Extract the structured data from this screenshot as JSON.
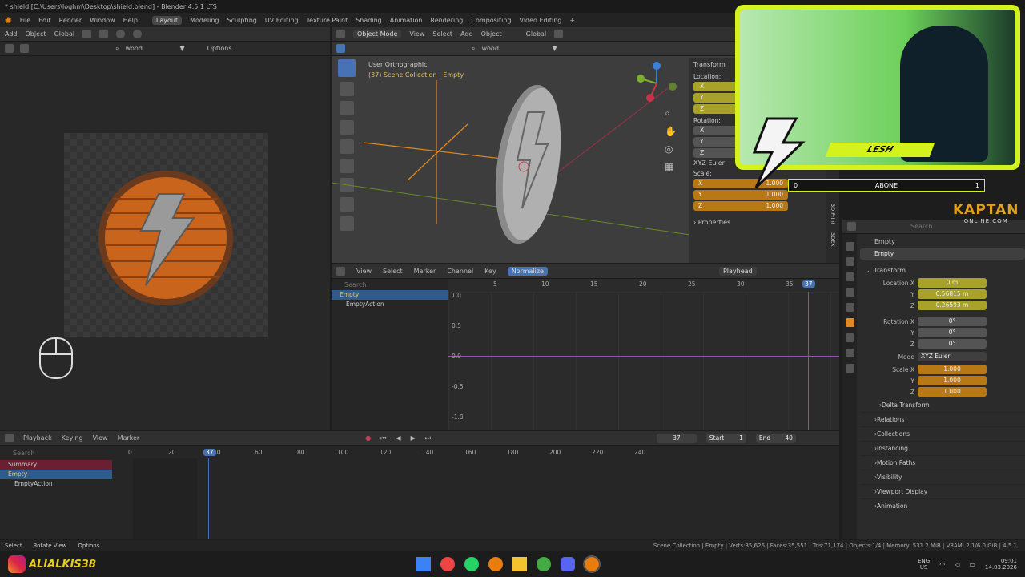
{
  "app": {
    "title": "* shield [C:\\Users\\loghm\\Desktop\\shield.blend] - Blender 4.5.1 LTS"
  },
  "menu": [
    "File",
    "Edit",
    "Render",
    "Window",
    "Help"
  ],
  "workspaces": [
    "Layout",
    "Modeling",
    "Sculpting",
    "UV Editing",
    "Texture Paint",
    "Shading",
    "Animation",
    "Rendering",
    "Compositing",
    "Video Editing"
  ],
  "left_editor": {
    "add": "Add",
    "object": "Object",
    "orientation": "Global",
    "search": "wood",
    "options": "Options"
  },
  "viewport": {
    "mode": "Object Mode",
    "menus": [
      "View",
      "Select",
      "Add",
      "Object"
    ],
    "orientation": "Global",
    "search": "wood",
    "view_name": "User Orthographic",
    "collection": "(37) Scene Collection | Empty",
    "side_tabs": [
      "Item",
      "Tool",
      "View",
      "3D Print",
      "3DEX"
    ]
  },
  "n_panel": {
    "transform": "Transform",
    "location": "Location:",
    "rotation": "Rotation:",
    "axes": [
      "X",
      "Y",
      "Z"
    ],
    "rotation_mode": "XYZ Euler",
    "scale": "Scale:",
    "scale_values": [
      "1.000",
      "1.000",
      "1.000"
    ],
    "properties": "Properties"
  },
  "graph": {
    "menus": [
      "View",
      "Select",
      "Marker",
      "Channel",
      "Key"
    ],
    "normalize": "Normalize",
    "playhead": "Playhead",
    "search": "Search",
    "frames": [
      "5",
      "10",
      "15",
      "20",
      "25",
      "30",
      "35"
    ],
    "current_frame": "37",
    "y_labels": [
      "1.0",
      "0.5",
      "0.0",
      "-0.5",
      "-1.0"
    ],
    "channels": [
      "Empty",
      "EmptyAction"
    ]
  },
  "timeline": {
    "menus": [
      "Playback",
      "Keying",
      "View",
      "Marker"
    ],
    "frame": "37",
    "start_label": "Start",
    "start": "1",
    "end_label": "End",
    "end": "40",
    "ticks": [
      "0",
      "20",
      "40",
      "60",
      "80",
      "100",
      "120",
      "140",
      "160",
      "180",
      "200",
      "220",
      "240"
    ],
    "current": "37",
    "channels": [
      "Summary",
      "Empty",
      "EmptyAction"
    ],
    "search": "Search"
  },
  "properties": {
    "object": "Empty",
    "data": "Empty",
    "transform": "Transform",
    "location": {
      "label": "Location X",
      "x": "0 m",
      "y": "0.56815 m",
      "z": "0.26593 m"
    },
    "rotation": {
      "label": "Rotation X",
      "x": "0°",
      "y": "0°",
      "z": "0°"
    },
    "mode_label": "Mode",
    "mode": "XYZ Euler",
    "scale": {
      "label": "Scale X",
      "x": "1.000",
      "y": "1.000",
      "z": "1.000"
    },
    "y_label": "Y",
    "z_label": "Z",
    "delta": "Delta Transform",
    "sections": [
      "Relations",
      "Collections",
      "Instancing",
      "Motion Paths",
      "Visibility",
      "Viewport Display",
      "Animation"
    ],
    "search": "Search"
  },
  "statusbar": {
    "select": "Select",
    "rotate": "Rotate View",
    "options": "Options",
    "info": "Scene Collection | Empty | Verts:35,626 | Faces:35,551 | Tris:71,174 | Objects:1/4 | Memory: 531.2 MiB | VRAM: 2.1/6.0 GiB | 4.5.1"
  },
  "overlay": {
    "handle": "ALIALKIS38",
    "name": "LESH",
    "abone_label": "ABONE",
    "abone_left": "0",
    "abone_right": "1",
    "brand_top": "KAPTAN",
    "brand_bottom": "ONLINE.COM"
  },
  "taskbar": {
    "lang": "ENG",
    "region": "US",
    "time": "09:01",
    "date": "14.03.2026"
  },
  "colors": {
    "accent": "#4772b3",
    "yellow_field": "#a8a12a",
    "orange_field": "#b87816",
    "stream_green": "#d4f21c"
  }
}
